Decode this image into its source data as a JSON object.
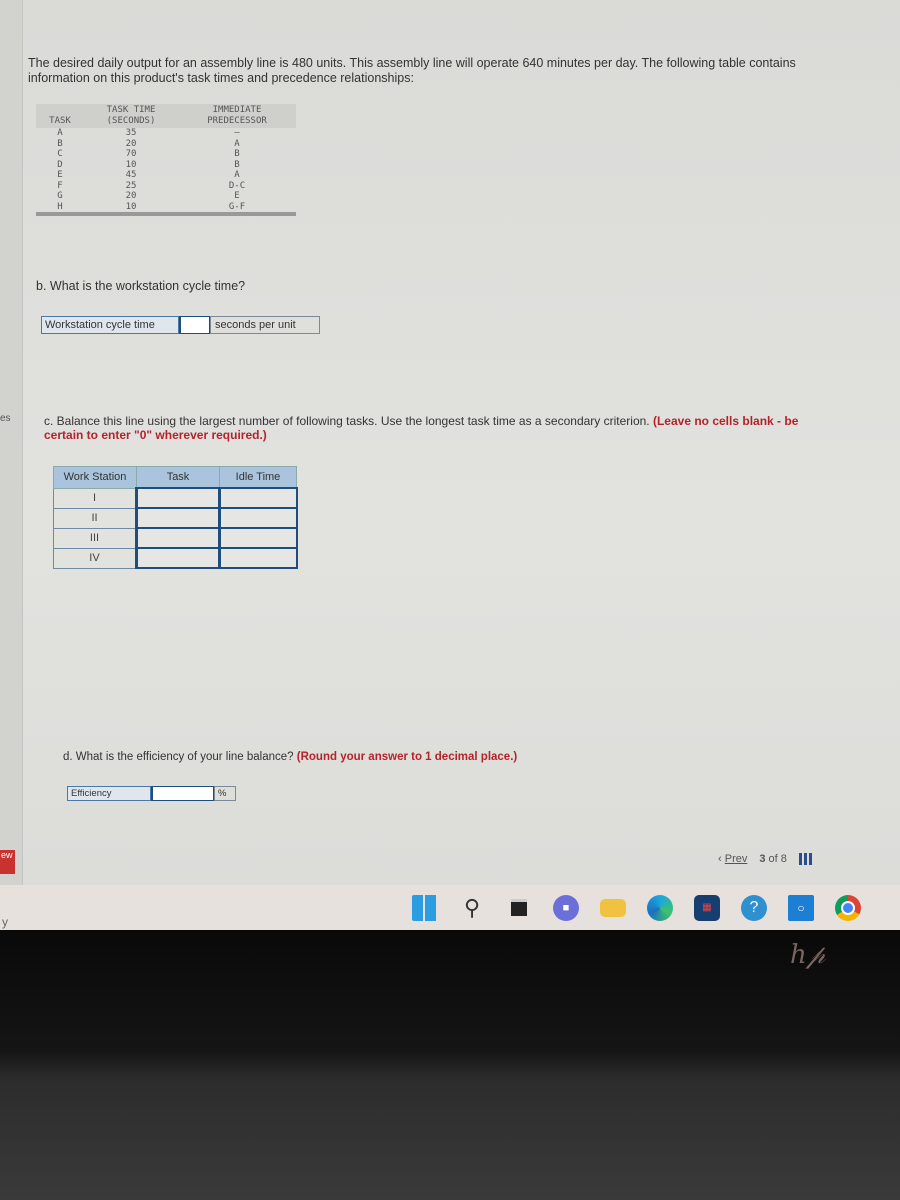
{
  "intro": "The desired daily output for an assembly line is 480 units. This assembly line will operate 640 minutes per day. The following table contains information on this product's task times and precedence relationships:",
  "task_table": {
    "headers": [
      "TASK",
      "TASK TIME (SECONDS)",
      "IMMEDIATE PREDECESSOR"
    ],
    "rows": [
      [
        "A",
        "35",
        "–"
      ],
      [
        "B",
        "20",
        "A"
      ],
      [
        "C",
        "70",
        "B"
      ],
      [
        "D",
        "10",
        "B"
      ],
      [
        "E",
        "45",
        "A"
      ],
      [
        "F",
        "25",
        "D-C"
      ],
      [
        "G",
        "20",
        "E"
      ],
      [
        "H",
        "10",
        "G-F"
      ]
    ]
  },
  "part_b": {
    "question": "b. What is the workstation cycle time?",
    "label": "Workstation cycle time",
    "value": "",
    "unit": "seconds per unit"
  },
  "part_c": {
    "question": "c. Balance this line using the largest number of following tasks. Use the longest task time as a secondary criterion.",
    "instruction": "(Leave no cells blank - be certain to enter \"0\" wherever required.)",
    "headers": [
      "Work Station",
      "Task",
      "Idle Time"
    ],
    "rows": [
      {
        "station": "I",
        "task": "",
        "idle": ""
      },
      {
        "station": "II",
        "task": "",
        "idle": ""
      },
      {
        "station": "III",
        "task": "",
        "idle": ""
      },
      {
        "station": "IV",
        "task": "",
        "idle": ""
      }
    ]
  },
  "part_d": {
    "question": "d. What is the efficiency of your line balance?",
    "instruction": "(Round your answer to 1 decimal place.)",
    "label": "Efficiency",
    "value": "",
    "unit": "%"
  },
  "nav": {
    "prev": "Prev",
    "current": "3",
    "of": "of 8"
  },
  "left_strip": {
    "a": "es",
    "b": "ew",
    "c": "y"
  },
  "taskbar": {
    "icons": [
      "windows-start",
      "search",
      "task-view",
      "teams-chat",
      "file-explorer",
      "edge",
      "microsoft-store",
      "help",
      "cortana",
      "chrome"
    ]
  },
  "logo": "hp"
}
